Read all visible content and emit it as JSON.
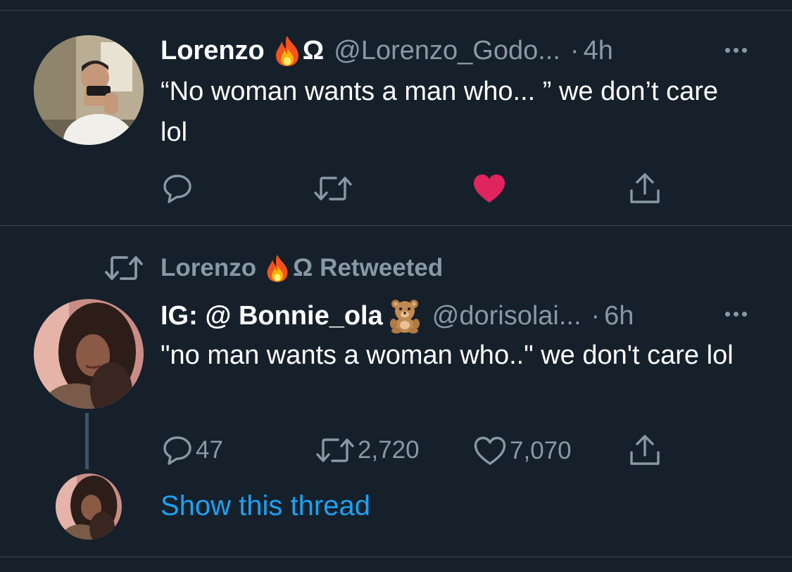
{
  "tweet1": {
    "name": "Lorenzo",
    "name_suffix": "Ω",
    "handle": "@Lorenzo_Godo...",
    "dot": "·",
    "time": "4h",
    "text": "“No woman wants a man who... ” we don’t care lol",
    "liked": true,
    "icons": [
      "reply-icon",
      "retweet-icon",
      "heart-filled-icon",
      "share-icon"
    ],
    "accent_like": "#e0245e"
  },
  "retweet_banner": {
    "name": "Lorenzo",
    "name_suffix": "Ω",
    "label": "Retweeted"
  },
  "tweet2": {
    "name": "IG: @ Bonnie_ola",
    "handle": "@dorisolai...",
    "dot": "·",
    "time": "6h",
    "text": "\"no man wants a woman who..\" we don't care lol",
    "replies": "47",
    "retweets": "2,720",
    "likes": "7,070",
    "icons": [
      "reply-icon",
      "retweet-icon",
      "heart-outline-icon",
      "share-icon"
    ]
  },
  "thread": {
    "show_thread_label": "Show this thread"
  },
  "colors": {
    "background": "#15202b",
    "secondary_text": "#8899a6",
    "link": "#1da1f2",
    "divider": "#38444d"
  }
}
